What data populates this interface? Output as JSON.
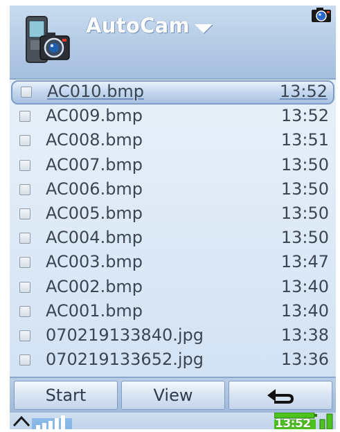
{
  "header": {
    "title": "AutoCam",
    "app_icon": "camera-phone-icon",
    "indicator_icon": "camera-indicator-icon"
  },
  "files": [
    {
      "name": "AC010.bmp",
      "time": "13:52",
      "selected": true
    },
    {
      "name": "AC009.bmp",
      "time": "13:52",
      "selected": false
    },
    {
      "name": "AC008.bmp",
      "time": "13:51",
      "selected": false
    },
    {
      "name": "AC007.bmp",
      "time": "13:50",
      "selected": false
    },
    {
      "name": "AC006.bmp",
      "time": "13:50",
      "selected": false
    },
    {
      "name": "AC005.bmp",
      "time": "13:50",
      "selected": false
    },
    {
      "name": "AC004.bmp",
      "time": "13:50",
      "selected": false
    },
    {
      "name": "AC003.bmp",
      "time": "13:47",
      "selected": false
    },
    {
      "name": "AC002.bmp",
      "time": "13:40",
      "selected": false
    },
    {
      "name": "AC001.bmp",
      "time": "13:40",
      "selected": false
    },
    {
      "name": "070219133840.jpg",
      "time": "13:38",
      "selected": false
    },
    {
      "name": "070219133652.jpg",
      "time": "13:36",
      "selected": false
    }
  ],
  "softkeys": {
    "start_label": "Start",
    "view_label": "View",
    "back_icon": "back-arrow-icon"
  },
  "status": {
    "clock": "13:52",
    "signal_icon": "signal-strength-icon",
    "up_icon": "chevron-up-icon",
    "battery_icon": "battery-icon"
  },
  "colors": {
    "header": "#b4cbe6",
    "accent": "#7f9cc4",
    "text": "#3b4654",
    "battery_green": "#4cc21e"
  }
}
